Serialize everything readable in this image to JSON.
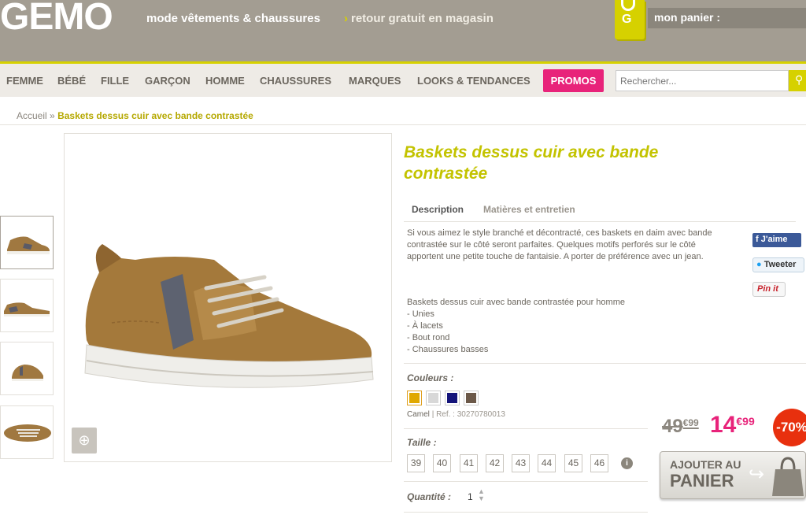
{
  "header": {
    "logo": "GEMO",
    "tagline": "mode vêtements & chaussures",
    "tagline2": "retour gratuit en magasin",
    "cart_icon_letter": "G",
    "cart_label": "mon panier :"
  },
  "nav": {
    "items": [
      "FEMME",
      "BÉBÉ",
      "FILLE",
      "GARÇON",
      "HOMME",
      "CHAUSSURES",
      "MARQUES",
      "LOOKS & TENDANCES"
    ],
    "promos": "PROMOS",
    "search_placeholder": "Rechercher..."
  },
  "breadcrumb": {
    "home": "Accueil",
    "separator": "»",
    "current": "Baskets dessus cuir avec bande contrastée"
  },
  "product": {
    "title": "Baskets dessus cuir avec bande contrastée",
    "tabs": [
      "Description",
      "Matières et entretien"
    ],
    "description": "Si vous aimez le style branché et décontracté, ces baskets en daim avec bande contrastée sur le côté seront parfaites. Quelques motifs perforés sur le côté apportent une petite touche de fantaisie. A porter de préférence avec un jean.",
    "features_title": "Baskets dessus cuir avec bande contrastée pour homme",
    "features": [
      "- Unies",
      "- À lacets",
      "- Bout rond",
      "- Chaussures basses"
    ],
    "colors_label": "Couleurs :",
    "colors": [
      "#e0a800",
      "#d8d8d8",
      "#14147a",
      "#6b5848"
    ],
    "color_name": "Camel",
    "ref_sep": "| Ref. :",
    "ref": "30270780013",
    "size_label": "Taille :",
    "sizes": [
      "39",
      "40",
      "41",
      "42",
      "43",
      "44",
      "45",
      "46"
    ],
    "quantity_label": "Quantité :",
    "quantity": "1",
    "old_price_int": "49",
    "old_price_dec": "€99",
    "new_price_int": "14",
    "new_price_dec": "€99",
    "discount": "-70%",
    "add_to_cart_line1": "AJOUTER AU",
    "add_to_cart_line2": "PANIER"
  },
  "social": {
    "facebook": "J'aime",
    "twitter": "Tweeter",
    "pinterest": "Pin it"
  },
  "colors": {
    "brand_yellow": "#d6d100",
    "promo_pink": "#e8237a",
    "header_bg": "#a39d92"
  }
}
